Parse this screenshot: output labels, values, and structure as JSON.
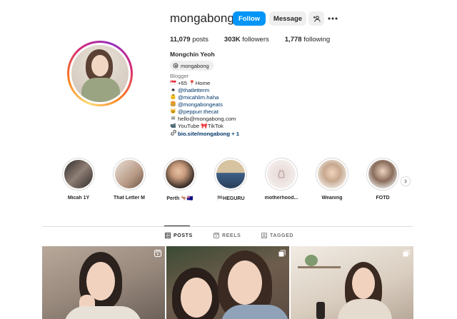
{
  "profile": {
    "username": "mongabong",
    "verified": true,
    "follow_label": "Follow",
    "message_label": "Message",
    "add_user_icon": "add-user-icon",
    "more_icon": "more-icon",
    "stats": {
      "posts_count": "11,079",
      "posts_label": "posts",
      "followers_count": "303K",
      "followers_label": "followers",
      "following_count": "1,778",
      "following_label": "following"
    },
    "full_name": "Mongchin Yeoh",
    "threads_handle": "mongabong",
    "bio": {
      "category": "Blogger",
      "lines": [
        {
          "emoji": "🇸🇬",
          "text": "+65 📍Home"
        },
        {
          "emoji": "♣",
          "text": "@thatletterm"
        },
        {
          "emoji": "👶",
          "text": "@micahlim.haha"
        },
        {
          "emoji": "🍔",
          "text": "@mongabongeats"
        },
        {
          "emoji": "😺",
          "text": "@peppurr.thecat"
        },
        {
          "emoji": "✉",
          "text": "hello@mongabong.com"
        },
        {
          "emoji": "📹",
          "text": "YouTube 🎀TikTok"
        }
      ],
      "link_text": "bio.site/mongabong + 1"
    }
  },
  "highlights": [
    {
      "label": "Micah 1Y",
      "color_a": "#2f2b2a",
      "color_b": "#8f7f75"
    },
    {
      "label": "That Letter M",
      "color_a": "#e9dfd6",
      "color_b": "#b89a86"
    },
    {
      "label": "Perth 🦘🇦🇺",
      "color_a": "#3a2e28",
      "color_b": "#c89a7c"
    },
    {
      "label": "🏁HEGURU",
      "color_a": "#d7c3a0",
      "color_b": "#3d5f86"
    },
    {
      "label": "motherhood...",
      "color_a": "#f3ecea",
      "color_b": "#e4d7d4"
    },
    {
      "label": "Weaning",
      "color_a": "#eae3d8",
      "color_b": "#c7a88f"
    },
    {
      "label": "FOTD",
      "color_a": "#e0ddd9",
      "color_b": "#8a6d5c"
    }
  ],
  "tabs": [
    {
      "label": "POSTS",
      "icon": "grid-icon",
      "active": true
    },
    {
      "label": "REELS",
      "icon": "reels-icon",
      "active": false
    },
    {
      "label": "TAGGED",
      "icon": "tagged-icon",
      "active": false
    }
  ],
  "posts": [
    {
      "type": "reel",
      "badge_icon": "reel-icon"
    },
    {
      "type": "carousel",
      "badge_icon": "carousel-icon"
    },
    {
      "type": "carousel",
      "badge_icon": "carousel-icon"
    }
  ],
  "colors": {
    "follow_button": "#0095f6",
    "link": "#00376b",
    "text": "#262626",
    "muted": "#737373"
  }
}
